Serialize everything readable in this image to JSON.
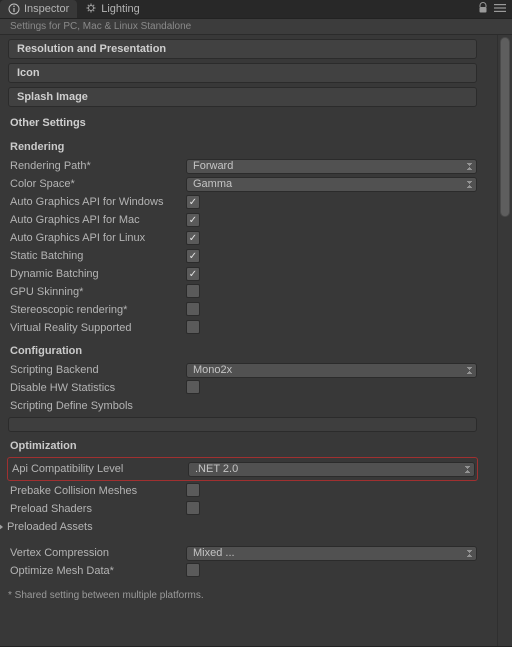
{
  "tabs": {
    "inspector": "Inspector",
    "lighting": "Lighting"
  },
  "headerstrip": "Settings for PC, Mac & Linux Standalone",
  "sections": {
    "resolution": "Resolution and Presentation",
    "icon": "Icon",
    "splash": "Splash Image",
    "other": "Other Settings"
  },
  "rendering": {
    "heading": "Rendering",
    "rows": {
      "renderingPath": {
        "label": "Rendering Path*",
        "value": "Forward"
      },
      "colorSpace": {
        "label": "Color Space*",
        "value": "Gamma"
      },
      "autoGraphicsWin": {
        "label": "Auto Graphics API for Windows",
        "checked": true
      },
      "autoGraphicsMac": {
        "label": "Auto Graphics API for Mac",
        "checked": true
      },
      "autoGraphicsLinux": {
        "label": "Auto Graphics API for Linux",
        "checked": true
      },
      "staticBatching": {
        "label": "Static Batching",
        "checked": true
      },
      "dynamicBatching": {
        "label": "Dynamic Batching",
        "checked": true
      },
      "gpuSkinning": {
        "label": "GPU Skinning*",
        "checked": false
      },
      "stereoscopic": {
        "label": "Stereoscopic rendering*",
        "checked": false
      },
      "vrSupported": {
        "label": "Virtual Reality Supported",
        "checked": false
      }
    }
  },
  "configuration": {
    "heading": "Configuration",
    "rows": {
      "scriptingBackend": {
        "label": "Scripting Backend",
        "value": "Mono2x"
      },
      "disableHWStats": {
        "label": "Disable HW Statistics",
        "checked": false
      },
      "scriptingDefine": {
        "label": "Scripting Define Symbols",
        "value": ""
      }
    }
  },
  "optimization": {
    "heading": "Optimization",
    "rows": {
      "apiCompat": {
        "label": "Api Compatibility Level",
        "value": ".NET 2.0"
      },
      "prebakeCollision": {
        "label": "Prebake Collision Meshes",
        "checked": false
      },
      "preloadShaders": {
        "label": "Preload Shaders",
        "checked": false
      },
      "preloadedAssets": {
        "label": "Preloaded Assets"
      },
      "vertexCompression": {
        "label": "Vertex Compression",
        "value": "Mixed ..."
      },
      "optimizeMesh": {
        "label": "Optimize Mesh Data*",
        "checked": false
      }
    }
  },
  "footnote": "* Shared setting between multiple platforms."
}
